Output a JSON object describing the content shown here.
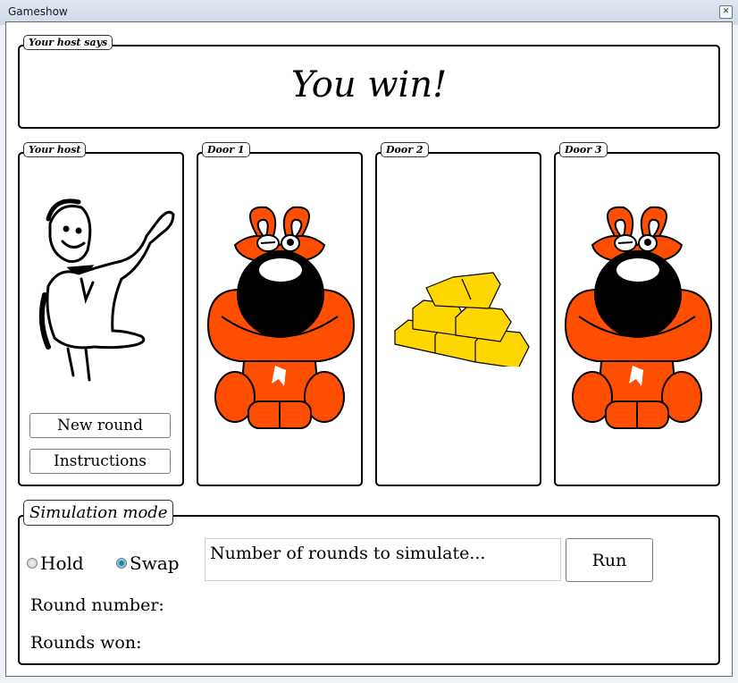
{
  "window": {
    "title": "Gameshow",
    "close_icon": "close-icon"
  },
  "host_says": {
    "label": "Your host says",
    "message": "You win!"
  },
  "host_panel": {
    "label": "Your host",
    "image": "game-show-host-illustration",
    "buttons": {
      "new_round": "New round",
      "instructions": "Instructions"
    }
  },
  "doors": [
    {
      "label": "Door 1",
      "content": "goat"
    },
    {
      "label": "Door 2",
      "content": "gold-bars"
    },
    {
      "label": "Door 3",
      "content": "goat"
    }
  ],
  "simulation": {
    "label": "Simulation mode",
    "options": [
      {
        "label": "Hold",
        "selected": false
      },
      {
        "label": "Swap",
        "selected": true
      }
    ],
    "rounds_input": {
      "value": "Number of rounds to simulate..."
    },
    "run_label": "Run",
    "round_number_label": "Round number:",
    "round_number_value": "",
    "rounds_won_label": "Rounds won:",
    "rounds_won_value": ""
  },
  "colors": {
    "goat_orange": "#ff4e00",
    "gold": "#ffd700",
    "radio_selected": "#2a7fa8"
  }
}
